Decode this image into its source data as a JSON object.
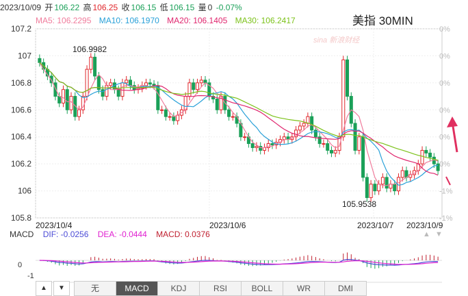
{
  "header": {
    "date": "2023/10/09",
    "open_label": "开",
    "open": "106.22",
    "high_label": "高",
    "high": "106.25",
    "close_label": "收",
    "close": "106.15",
    "low_label": "低",
    "low": "106.15",
    "volume_label": "量",
    "volume": "0",
    "change": "-0.07%"
  },
  "ma": {
    "ma5": "MA5: 106.2295",
    "ma10": "MA10: 106.1970",
    "ma20": "MA20: 106.1405",
    "ma30": "MA30: 106.2417"
  },
  "title": "美指 30MIN",
  "watermark": "sina 新浪财经",
  "y_labels": [
    "107.2",
    "107",
    "106.8",
    "106.6",
    "106.4",
    "106.2",
    "106",
    "105.8"
  ],
  "pct_labels": [
    "0%",
    "0%",
    "0%",
    "0%",
    "0%",
    "0%",
    "-1%",
    "-1%"
  ],
  "annotations": {
    "high_label": "106.9982",
    "low_label": "105.9538"
  },
  "x_labels": [
    "2023/10/4",
    "2023/10/6",
    "2023/10/7",
    "2023/10/9"
  ],
  "macd": {
    "name": "MACD",
    "dif": "DIF: -0.0256",
    "dea": "DEA: -0.0444",
    "macd": "MACD: 0.0376"
  },
  "macd_y_labels": [
    "0",
    "-1"
  ],
  "tabs": [
    "无",
    "MACD",
    "KDJ",
    "RSI",
    "BOLL",
    "WR",
    "DMI"
  ],
  "active_tab": "MACD",
  "nav": {
    "up": "▲",
    "down": "▼"
  },
  "colors": {
    "up": "#e0262b",
    "down": "#1aa058",
    "ma5": "#f07c9c",
    "ma10": "#28a0d8",
    "ma20": "#e0266e",
    "ma30": "#7cc21a",
    "dif": "#4b4bd6",
    "dea": "#e020d0"
  },
  "chart_data": {
    "type": "candlestick",
    "ylim": [
      105.8,
      107.2
    ],
    "close_series": [
      106.95,
      106.9,
      106.85,
      106.8,
      106.7,
      106.65,
      106.75,
      106.6,
      106.7,
      106.55,
      106.6,
      106.7,
      106.9,
      106.99,
      106.85,
      106.75,
      106.7,
      106.78,
      106.8,
      106.75,
      106.7,
      106.8,
      106.82,
      106.78,
      106.75,
      106.76,
      106.78,
      106.8,
      106.79,
      106.78,
      106.6,
      106.6,
      106.55,
      106.55,
      106.52,
      106.56,
      106.6,
      106.7,
      106.8,
      106.75,
      106.8,
      106.82,
      106.8,
      106.7,
      106.68,
      106.6,
      106.7,
      106.6,
      106.55,
      106.55,
      106.5,
      106.4,
      106.4,
      106.35,
      106.32,
      106.33,
      106.3,
      106.32,
      106.35,
      106.34,
      106.36,
      106.38,
      106.4,
      106.38,
      106.4,
      106.45,
      106.48,
      106.5,
      106.55,
      106.45,
      106.4,
      106.35,
      106.35,
      106.3,
      106.28,
      106.3,
      106.4,
      106.97,
      106.7,
      106.5,
      106.3,
      106.4,
      106.1,
      105.95,
      106.05,
      106.0,
      106.05,
      106.1,
      106.02,
      106.05,
      106.0,
      106.1,
      106.15,
      106.1,
      106.12,
      106.15,
      106.2,
      106.3,
      106.28,
      106.25,
      106.2,
      106.15
    ],
    "ma5": [
      106.95,
      106.9,
      106.86,
      106.82,
      106.76,
      106.7,
      106.69,
      106.66,
      106.66,
      106.63,
      106.6,
      106.62,
      106.69,
      106.76,
      106.82,
      106.86,
      106.83,
      106.78,
      106.75,
      106.75,
      106.75,
      106.77,
      106.78,
      106.78,
      106.77,
      106.77,
      106.78,
      106.78,
      106.77,
      106.76,
      106.72,
      106.67,
      106.62,
      106.58,
      106.55,
      106.56,
      106.58,
      106.6,
      106.65,
      106.69,
      106.73,
      106.77,
      106.8,
      106.78,
      106.76,
      106.72,
      106.7,
      106.65,
      106.62,
      106.58,
      106.55,
      106.5,
      106.45,
      106.4,
      106.36,
      106.34,
      106.32,
      106.32,
      106.33,
      106.33,
      106.35,
      106.36,
      106.38,
      106.38,
      106.39,
      106.41,
      106.43,
      106.45,
      106.48,
      106.49,
      106.47,
      106.44,
      106.41,
      106.38,
      106.34,
      106.32,
      106.33,
      106.45,
      106.55,
      106.6,
      106.58,
      106.55,
      106.45,
      106.3,
      106.2,
      106.1,
      106.05,
      106.04,
      106.04,
      106.05,
      106.05,
      106.06,
      106.08,
      106.1,
      106.12,
      106.13,
      106.15,
      106.18,
      106.21,
      106.22,
      106.23,
      106.22
    ]
  }
}
